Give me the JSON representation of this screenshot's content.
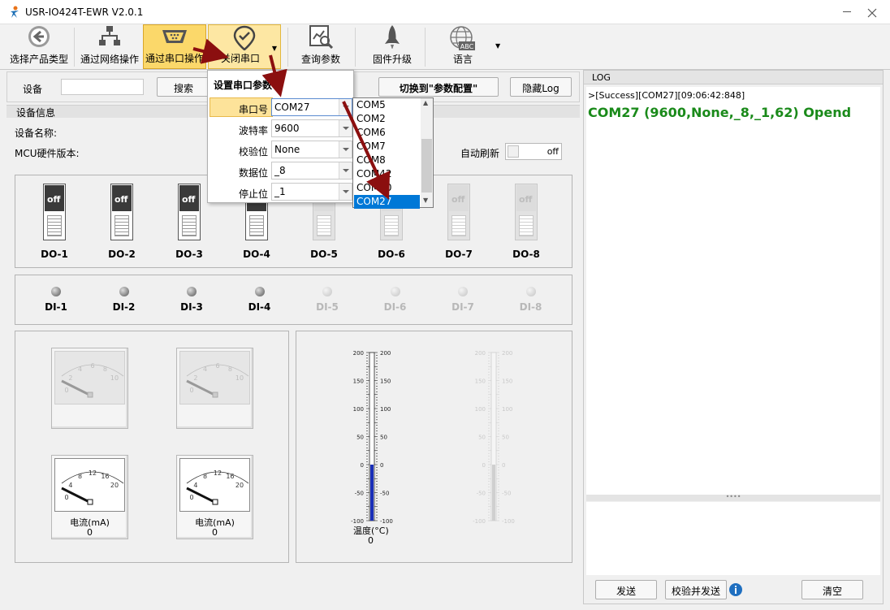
{
  "window": {
    "title": "USR-IO424T-EWR V2.0.1"
  },
  "ribbon": {
    "select_product": "选择产品类型",
    "net_op": "通过网络操作",
    "serial_op": "通过串口操作",
    "close_serial": "关闭串口",
    "query_params": "查询参数",
    "firmware": "固件升级",
    "language": "语言"
  },
  "toolbar": {
    "device_label": "设备",
    "search": "搜索",
    "switch_cfg": "切换到\"参数配置\"",
    "hide_log": "隐藏Log"
  },
  "device_info": {
    "section": "设备信息",
    "name_label": "设备名称:",
    "mcu_label": "MCU硬件版本:",
    "auto_refresh": "自动刷新",
    "toggle": "off"
  },
  "serial_popup": {
    "title": "设置串口参数",
    "port_label": "串口号",
    "port_value": "COM27",
    "baud_label": "波特率",
    "baud_value": "9600",
    "parity_label": "校验位",
    "parity_value": "None",
    "data_label": "数据位",
    "data_value": "_8",
    "stop_label": "停止位",
    "stop_value": "_1",
    "options": [
      "COM5",
      "COM2",
      "COM6",
      "COM7",
      "COM8",
      "COM42",
      "COM40",
      "COM27"
    ],
    "selected": "COM27"
  },
  "do": {
    "switch": "off",
    "labels": [
      "DO-1",
      "DO-2",
      "DO-3",
      "DO-4",
      "DO-5",
      "DO-6",
      "DO-7",
      "DO-8"
    ]
  },
  "di": {
    "labels": [
      "DI-1",
      "DI-2",
      "DI-3",
      "DI-4",
      "DI-5",
      "DI-6",
      "DI-7",
      "DI-8"
    ]
  },
  "gauges": {
    "volt_ticks": [
      "0",
      "2",
      "4",
      "6",
      "8",
      "10"
    ],
    "current_ticks": [
      "0",
      "4",
      "8",
      "12",
      "16",
      "20"
    ],
    "current_label": "电流(mA)",
    "current_value": "0"
  },
  "thermo": {
    "label": "温度(°C)",
    "value": "0",
    "ticks": [
      "200",
      "150",
      "100",
      "50",
      "0",
      "-50",
      "-100"
    ]
  },
  "log": {
    "title": "LOG",
    "line1": ">[Success][COM27][09:06:42:848]",
    "line2": "COM27 (9600,None,_8,_1,62) Opend",
    "send": "发送",
    "verify_send": "校验并发送",
    "clear": "清空"
  }
}
